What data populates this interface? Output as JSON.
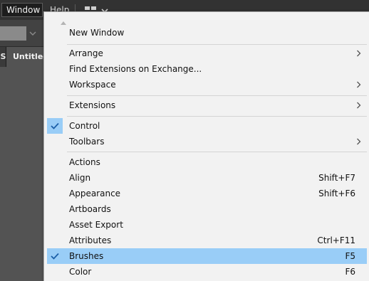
{
  "menubar": {
    "window_label": "Window",
    "help_label": "Help"
  },
  "document": {
    "tab_title": "Untitled-",
    "tab_edge_label": "S"
  },
  "menu": {
    "items": [
      {
        "label": "New Window"
      },
      {
        "label": "Arrange",
        "submenu": true
      },
      {
        "label": "Find Extensions on Exchange..."
      },
      {
        "label": "Workspace",
        "submenu": true
      },
      {
        "label": "Extensions",
        "submenu": true
      },
      {
        "label": "Control",
        "checked": true
      },
      {
        "label": "Toolbars",
        "submenu": true
      },
      {
        "label": "Actions"
      },
      {
        "label": "Align",
        "shortcut": "Shift+F7"
      },
      {
        "label": "Appearance",
        "shortcut": "Shift+F6"
      },
      {
        "label": "Artboards"
      },
      {
        "label": "Asset Export"
      },
      {
        "label": "Attributes",
        "shortcut": "Ctrl+F11"
      },
      {
        "label": "Brushes",
        "shortcut": "F5",
        "checked": true,
        "highlighted": true
      },
      {
        "label": "Color",
        "shortcut": "F6"
      }
    ]
  },
  "colors": {
    "menu_background": "#f2f2f2",
    "highlight": "#99cdf7",
    "check": "#1b5fa8",
    "menubar": "#323232",
    "workspace": "#535353"
  },
  "icons": {
    "check": "checkmark-icon",
    "submenu": "chevron-right-icon",
    "scroll_up": "triangle-up-icon",
    "workspace_switcher": "workspace-layout-icon"
  }
}
